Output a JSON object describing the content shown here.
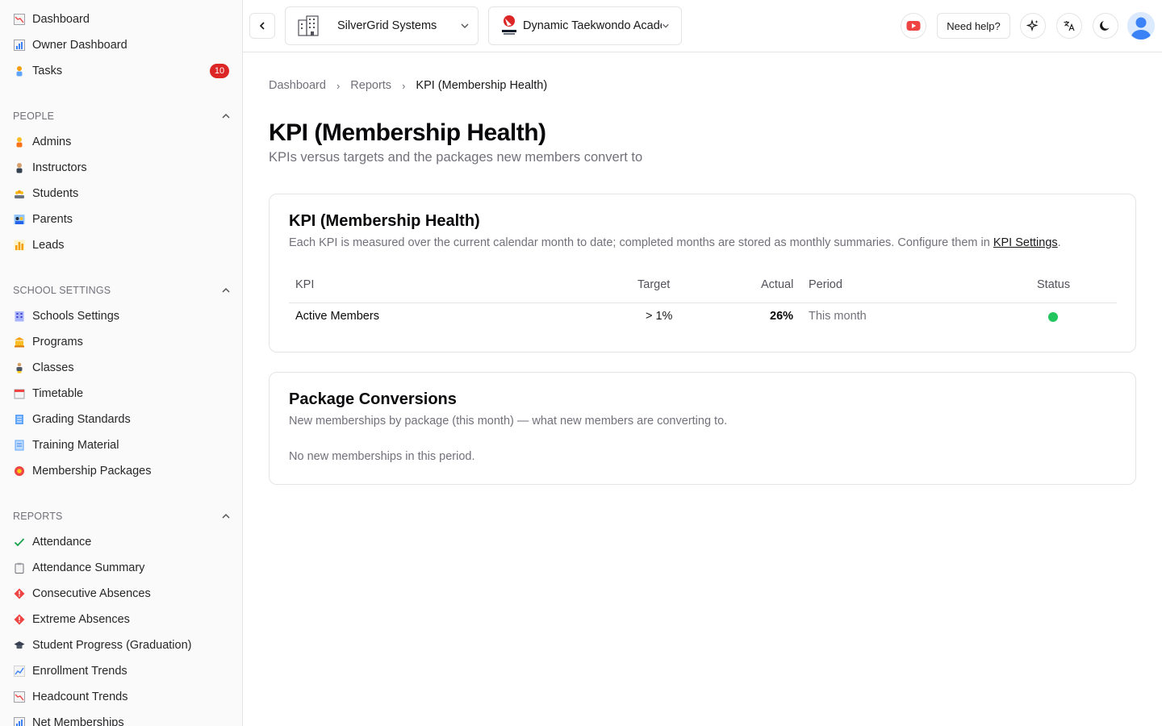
{
  "sidebar": {
    "top_items": [
      {
        "label": "Dashboard",
        "icon": "chart-down-icon"
      },
      {
        "label": "Owner Dashboard",
        "icon": "bar-chart-icon"
      },
      {
        "label": "Tasks",
        "icon": "person-icon",
        "badge": "10"
      }
    ],
    "sections": [
      {
        "title": "PEOPLE",
        "items": [
          {
            "label": "Admins",
            "icon": "person-orange-icon"
          },
          {
            "label": "Instructors",
            "icon": "person-dark-icon"
          },
          {
            "label": "Students",
            "icon": "group-icon"
          },
          {
            "label": "Parents",
            "icon": "family-icon"
          },
          {
            "label": "Leads",
            "icon": "bar-chart-yellow-icon"
          }
        ]
      },
      {
        "title": "SCHOOL SETTINGS",
        "items": [
          {
            "label": "Schools Settings",
            "icon": "building-icon"
          },
          {
            "label": "Programs",
            "icon": "bank-icon"
          },
          {
            "label": "Classes",
            "icon": "figure-icon"
          },
          {
            "label": "Timetable",
            "icon": "calendar-icon"
          },
          {
            "label": "Grading Standards",
            "icon": "document-icon"
          },
          {
            "label": "Training Material",
            "icon": "page-icon"
          },
          {
            "label": "Membership Packages",
            "icon": "medal-icon"
          }
        ]
      },
      {
        "title": "REPORTS",
        "items": [
          {
            "label": "Attendance",
            "icon": "checkmark-icon"
          },
          {
            "label": "Attendance Summary",
            "icon": "clipboard-icon"
          },
          {
            "label": "Consecutive Absences",
            "icon": "warning-diamond-icon"
          },
          {
            "label": "Extreme Absences",
            "icon": "warning-diamond-icon"
          },
          {
            "label": "Student Progress (Graduation)",
            "icon": "graduation-cap-icon"
          },
          {
            "label": "Enrollment Trends",
            "icon": "trend-up-icon"
          },
          {
            "label": "Headcount Trends",
            "icon": "chart-down-icon"
          },
          {
            "label": "Net Memberships",
            "icon": "bar-chart-icon"
          }
        ]
      }
    ]
  },
  "topbar": {
    "org_selector": "SilverGrid Systems",
    "school_selector": "Dynamic Taekwondo Academy",
    "help_label": "Need help?"
  },
  "breadcrumb": [
    "Dashboard",
    "Reports",
    "KPI (Membership Health)"
  ],
  "page": {
    "title": "KPI (Membership Health)",
    "subtitle": "KPIs versus targets and the packages new members convert to"
  },
  "kpi_card": {
    "title": "KPI (Membership Health)",
    "desc_prefix": "Each KPI is measured over the current calendar month to date; completed months are stored as monthly summaries. Configure them in ",
    "desc_link": "KPI Settings",
    "desc_suffix": ".",
    "columns": [
      "KPI",
      "Target",
      "Actual",
      "Period",
      "Status"
    ],
    "rows": [
      {
        "kpi": "Active Members",
        "target": "> 1%",
        "actual": "26%",
        "period": "This month",
        "status": "on-target",
        "status_color": "#22c55e"
      }
    ]
  },
  "package_card": {
    "title": "Package Conversions",
    "desc": "New memberships by package (this month) — what new members are converting to.",
    "empty": "No new memberships in this period."
  }
}
